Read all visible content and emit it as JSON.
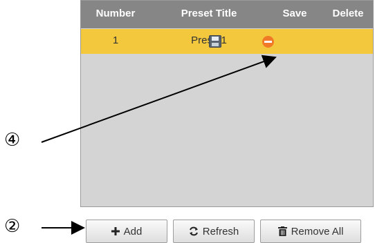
{
  "table": {
    "headers": [
      "Number",
      "Preset Title",
      "Save",
      "Delete"
    ],
    "rows": [
      {
        "number": "1",
        "title": "Preset1",
        "save_icon": "save-icon",
        "delete_icon": "delete-icon"
      }
    ],
    "selected_row_color": "#f4c83d",
    "header_color": "#868686"
  },
  "buttons": {
    "add": "Add",
    "refresh": "Refresh",
    "remove_all": "Remove All"
  },
  "callouts": {
    "four": "④",
    "two": "②"
  }
}
